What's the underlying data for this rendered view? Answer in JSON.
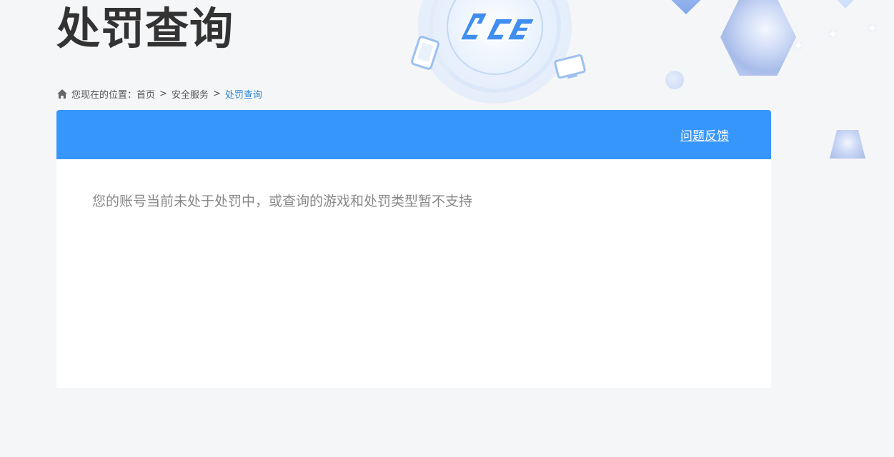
{
  "header": {
    "title": "处罚查询"
  },
  "breadcrumb": {
    "icon": "home-icon",
    "prefix": "您现在的位置：",
    "items": [
      "首页",
      "安全服务",
      "处罚查询"
    ],
    "separator": ">"
  },
  "panel": {
    "feedback_label": "问题反馈",
    "message": "您的账号当前未处于处罚中，或查询的游戏和处罚类型暂不支持"
  },
  "colors": {
    "accent": "#3796fb",
    "title_text": "#333333",
    "message_text": "#888888",
    "breadcrumb_current": "#2f86d6",
    "background": "#f5f6f7"
  }
}
